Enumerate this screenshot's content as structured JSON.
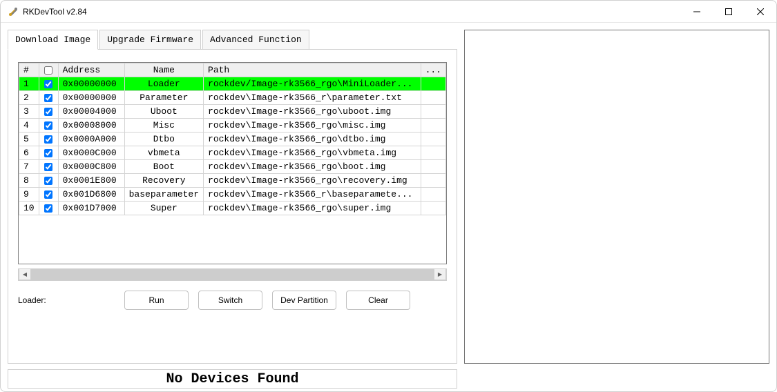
{
  "window": {
    "title": "RKDevTool v2.84"
  },
  "tabs": [
    {
      "label": "Download Image",
      "active": true
    },
    {
      "label": "Upgrade Firmware",
      "active": false
    },
    {
      "label": "Advanced Function",
      "active": false
    }
  ],
  "table": {
    "headers": {
      "index": "#",
      "checkbox": "",
      "address": "Address",
      "name": "Name",
      "path": "Path",
      "dots": "..."
    },
    "rows": [
      {
        "index": "1",
        "checked": true,
        "address": "0x00000000",
        "name": "Loader",
        "path": "rockdev/Image-rk3566_rgo\\MiniLoader...",
        "selected": true
      },
      {
        "index": "2",
        "checked": true,
        "address": "0x00000000",
        "name": "Parameter",
        "path": "rockdev\\Image-rk3566_r\\parameter.txt",
        "selected": false
      },
      {
        "index": "3",
        "checked": true,
        "address": "0x00004000",
        "name": "Uboot",
        "path": "rockdev\\Image-rk3566_rgo\\uboot.img",
        "selected": false
      },
      {
        "index": "4",
        "checked": true,
        "address": "0x00008000",
        "name": "Misc",
        "path": "rockdev\\Image-rk3566_rgo\\misc.img",
        "selected": false
      },
      {
        "index": "5",
        "checked": true,
        "address": "0x0000A000",
        "name": "Dtbo",
        "path": "rockdev\\Image-rk3566_rgo\\dtbo.img",
        "selected": false
      },
      {
        "index": "6",
        "checked": true,
        "address": "0x0000C000",
        "name": "vbmeta",
        "path": "rockdev\\Image-rk3566_rgo\\vbmeta.img",
        "selected": false
      },
      {
        "index": "7",
        "checked": true,
        "address": "0x0000C800",
        "name": "Boot",
        "path": "rockdev\\Image-rk3566_rgo\\boot.img",
        "selected": false
      },
      {
        "index": "8",
        "checked": true,
        "address": "0x0001E800",
        "name": "Recovery",
        "path": "rockdev\\Image-rk3566_rgo\\recovery.img",
        "selected": false
      },
      {
        "index": "9",
        "checked": true,
        "address": "0x001D6800",
        "name": "baseparameter",
        "path": "rockdev\\Image-rk3566_r\\baseparamete...",
        "selected": false
      },
      {
        "index": "10",
        "checked": true,
        "address": "0x001D7000",
        "name": "Super",
        "path": "rockdev\\Image-rk3566_rgo\\super.img",
        "selected": false
      }
    ]
  },
  "labels": {
    "loader": "Loader:"
  },
  "buttons": {
    "run": "Run",
    "switch": "Switch",
    "dev_partition": "Dev Partition",
    "clear": "Clear"
  },
  "status": {
    "text": "No Devices Found"
  }
}
